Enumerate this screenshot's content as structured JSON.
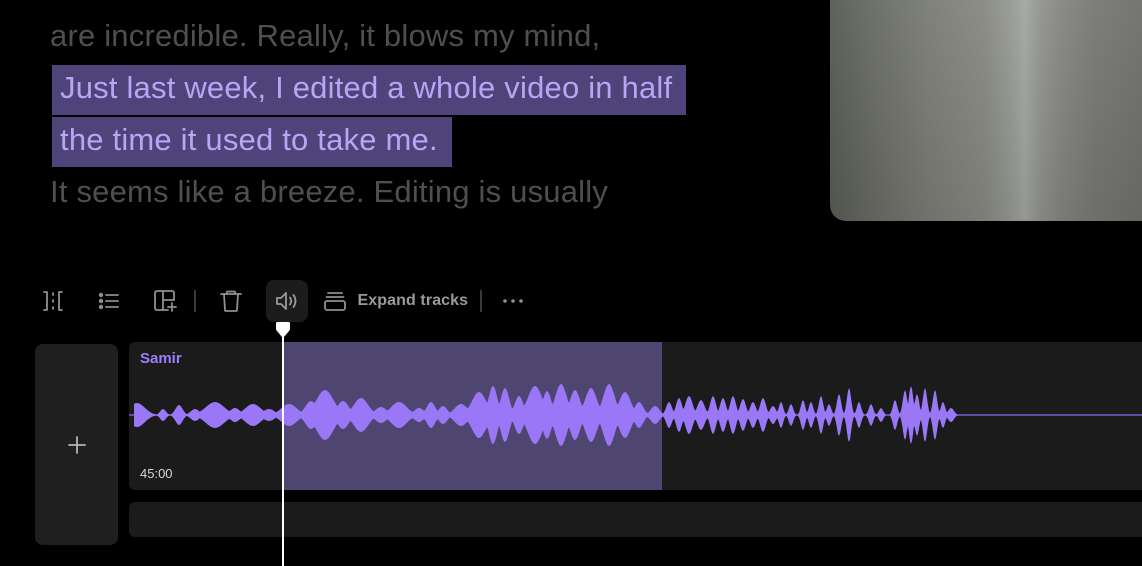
{
  "transcript": {
    "lines": [
      {
        "text": "are incredible. Really, it blows my mind,",
        "state": "dim"
      },
      {
        "text": "Just last week, I edited a whole video in half",
        "state": "highlighted"
      },
      {
        "text": "the time it used to take me.",
        "state": "highlighted"
      },
      {
        "text": "It seems like a breeze. Editing is usually",
        "state": "dim"
      }
    ],
    "highlight_color": "#4e447a",
    "highlight_text_color": "#b7a5f5"
  },
  "toolbar": {
    "buttons": [
      {
        "icon": "split-icon"
      },
      {
        "icon": "list-icon"
      },
      {
        "icon": "add-layout-icon"
      },
      {
        "icon": "trash-icon"
      },
      {
        "icon": "volume-icon",
        "active": true
      }
    ],
    "expand_label": "Expand tracks",
    "expand_icon": "stack-icon",
    "more_icon": "more-horizontal-icon"
  },
  "timeline": {
    "add_icon": "plus-icon",
    "track": {
      "name": "Samir",
      "time": "45:00",
      "accent": "#9d7dff",
      "selection_color": "#4e4570"
    }
  }
}
